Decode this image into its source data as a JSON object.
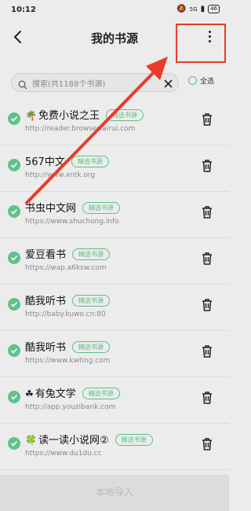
{
  "status": {
    "time": "10:12",
    "network": "5G",
    "battery": "46"
  },
  "header": {
    "title": "我的书源"
  },
  "search": {
    "placeholder": "搜索(共1188个书源)"
  },
  "select_all": {
    "label": "全选"
  },
  "items": [
    {
      "emoji": "🌴",
      "name": "免费小说之王",
      "tag": "精选书源",
      "url": "http://reader.browserfairui.com"
    },
    {
      "emoji": "",
      "name": "567中文",
      "tag": "精选书源",
      "url": "http://www.xntk.org"
    },
    {
      "emoji": "",
      "name": "书虫中文网",
      "tag": "精选书源",
      "url": "https://www.shuchong.info"
    },
    {
      "emoji": "",
      "name": "爱豆看书",
      "tag": "精选书源",
      "url": "https://wap.a6ksw.com"
    },
    {
      "emoji": "",
      "name": "酷我听书",
      "tag": "精选书源",
      "url": "http://baby.kuwo.cn:80"
    },
    {
      "emoji": "",
      "name": "酷我听书",
      "tag": "精选书源",
      "url": "https://www.kwting.com"
    },
    {
      "emoji": "☘",
      "name": "有兔文学",
      "tag": "精选书源",
      "url": "http://app.youzibank.com"
    },
    {
      "emoji": "🍀",
      "name": "读一读小说网②",
      "tag": "精选书源",
      "url": "https://www.du1du.cc"
    }
  ],
  "bottom": {
    "label": "本地导入"
  },
  "annotation": {
    "color": "#ea3a2a"
  },
  "colors": {
    "accent": "#5cbf86"
  }
}
